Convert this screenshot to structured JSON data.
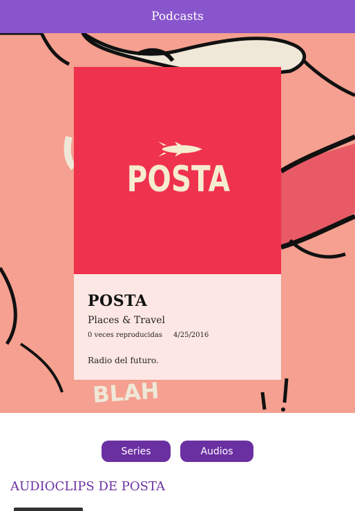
{
  "topbar": {
    "title": "Podcasts"
  },
  "podcast": {
    "name": "POSTA",
    "category": "Places & Travel",
    "plays": "0 veces reproducidas",
    "date": "4/25/2016",
    "description": "Radio del futuro.",
    "logo_text": "POSTA"
  },
  "tabs": {
    "series_label": "Series",
    "audios_label": "Audios"
  },
  "section": {
    "title": "AUDIOCLIPS DE POSTA"
  },
  "background_text": "BLAH",
  "colors": {
    "topbar": "#8855cc",
    "hero_bg": "#f5a090",
    "cover": "#ef324d",
    "logo": "#f6ecd0",
    "card": "#fde7e4",
    "accent": "#6a2fa1"
  }
}
